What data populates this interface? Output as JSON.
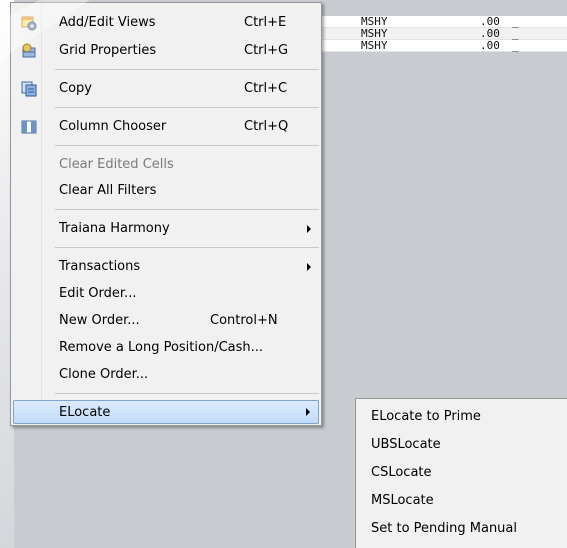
{
  "grid": {
    "rows": [
      {
        "symbol": "MSHY",
        "value": ".00",
        "flag": "_"
      },
      {
        "symbol": "MSHY",
        "value": ".00",
        "flag": "_"
      },
      {
        "symbol": "MSHY",
        "value": ".00",
        "flag": "_"
      }
    ]
  },
  "menu": {
    "items": [
      {
        "label": "Add/Edit Views",
        "shortcut": "Ctrl+E",
        "icon": "views-gear-icon"
      },
      {
        "label": "Grid Properties",
        "shortcut": "Ctrl+G",
        "icon": "grid-properties-icon"
      },
      {
        "label": "Copy",
        "shortcut": "Ctrl+C",
        "icon": "copy-icon"
      },
      {
        "label": "Column Chooser",
        "shortcut": "Ctrl+Q",
        "icon": "column-chooser-icon"
      },
      {
        "label": "Clear Edited Cells",
        "shortcut": "",
        "disabled": true
      },
      {
        "label": "Clear All Filters",
        "shortcut": ""
      },
      {
        "label": "Traiana Harmony",
        "shortcut": "",
        "submenu": true
      },
      {
        "label": "Transactions",
        "shortcut": "",
        "submenu": true
      },
      {
        "label": "Edit Order...",
        "shortcut": ""
      },
      {
        "label": "New Order...",
        "shortcut": "Control+N"
      },
      {
        "label": "Remove a Long Position/Cash...",
        "shortcut": ""
      },
      {
        "label": "Clone Order...",
        "shortcut": ""
      },
      {
        "label": "ELocate",
        "shortcut": "",
        "submenu": true,
        "highlighted": true
      }
    ]
  },
  "submenu": {
    "items": [
      {
        "label": "ELocate to Prime"
      },
      {
        "label": "UBSLocate"
      },
      {
        "label": "CSLocate"
      },
      {
        "label": "MSLocate"
      },
      {
        "label": "Set to Pending Manual"
      }
    ]
  },
  "colors": {
    "highlight_fill": "#c1dbfa",
    "highlight_border": "#7da2ce",
    "menu_bg": "#f1f1f1",
    "backdrop": "#c9ccd1"
  }
}
